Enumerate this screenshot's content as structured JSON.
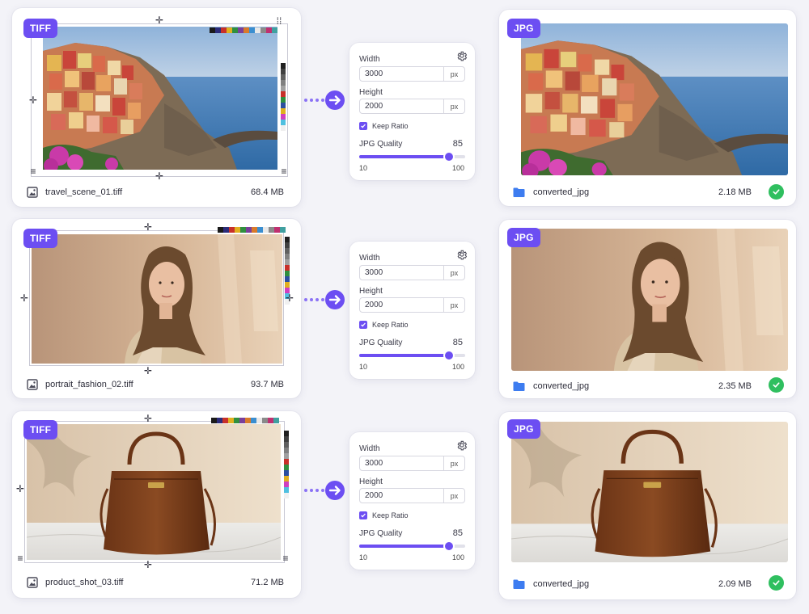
{
  "rows": [
    {
      "id": "travel",
      "source": {
        "format": "TIFF",
        "filename": "travel_scene_01.tiff",
        "size": "68.4 MB",
        "image_icon": "image-file-icon"
      },
      "settings": {
        "width_label": "Width",
        "width_value": "3000",
        "width_unit": "px",
        "height_label": "Height",
        "height_value": "2000",
        "height_unit": "px",
        "keep_ratio_label": "Keep Ratio",
        "keep_ratio": true,
        "quality_label": "JPG Quality",
        "quality_value": "85",
        "quality_min": "10",
        "quality_max": "100",
        "quality_level": 0.85
      },
      "result": {
        "format": "JPG",
        "folder": "converted_jpg",
        "size": "2.18 MB",
        "status": "success"
      }
    },
    {
      "id": "portrait",
      "source": {
        "format": "TIFF",
        "filename": "portrait_fashion_02.tiff",
        "size": "93.7 MB",
        "image_icon": "image-file-icon"
      },
      "settings": {
        "width_label": "Width",
        "width_value": "3000",
        "width_unit": "px",
        "height_label": "Height",
        "height_value": "2000",
        "height_unit": "px",
        "keep_ratio_label": "Keep Ratio",
        "keep_ratio": true,
        "quality_label": "JPG Quality",
        "quality_value": "85",
        "quality_min": "10",
        "quality_max": "100",
        "quality_level": 0.85
      },
      "result": {
        "format": "JPG",
        "folder": "converted_jpg",
        "size": "2.35 MB",
        "status": "success"
      }
    },
    {
      "id": "product",
      "source": {
        "format": "TIFF",
        "filename": "product_shot_03.tiff",
        "size": "71.2 MB",
        "image_icon": "image-file-icon"
      },
      "settings": {
        "width_label": "Width",
        "width_value": "3000",
        "width_unit": "px",
        "height_label": "Height",
        "height_value": "2000",
        "height_unit": "px",
        "keep_ratio_label": "Keep Ratio",
        "keep_ratio": true,
        "quality_label": "JPG Quality",
        "quality_value": "85",
        "quality_min": "10",
        "quality_max": "100",
        "quality_level": 0.85
      },
      "result": {
        "format": "JPG",
        "folder": "converted_jpg",
        "size": "2.09 MB",
        "status": "success"
      }
    }
  ],
  "colors": {
    "accent": "#6c4ef2",
    "success": "#2fbf5f",
    "folder": "#3d7cf0",
    "background": "#f3f3f8"
  },
  "icons": {
    "arrow": "arrow-right-circle-icon",
    "gear": "gear-icon",
    "folder": "folder-icon",
    "check": "check-circle-icon",
    "checkbox": "checkbox-checked-icon",
    "registration": "registration-mark-icon"
  }
}
